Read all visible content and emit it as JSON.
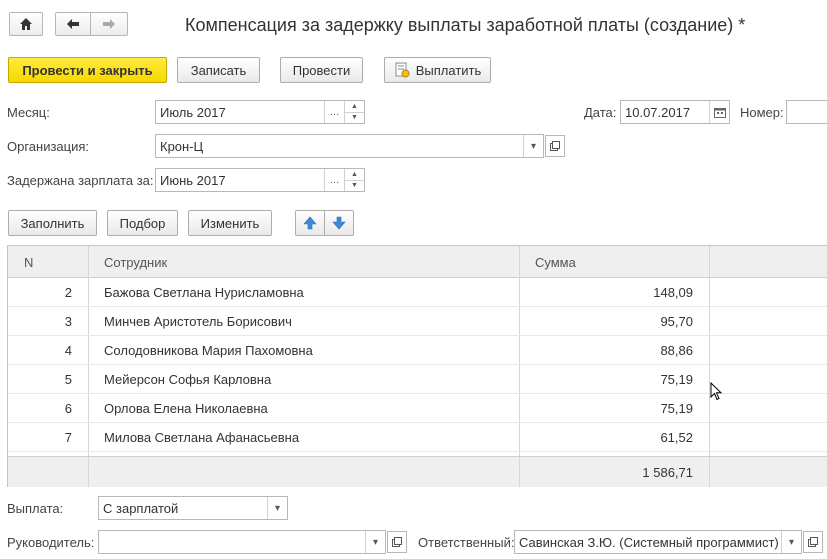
{
  "window": {
    "title": "Компенсация за задержку выплаты заработной платы (создание) *"
  },
  "nav": {
    "home_icon": "home-icon",
    "back_icon": "arrow-left-icon",
    "forward_icon": "arrow-right-icon"
  },
  "toolbar": {
    "post_close_label": "Провести и закрыть",
    "save_label": "Записать",
    "post_label": "Провести",
    "pay_label": "Выплатить"
  },
  "form": {
    "month_label": "Месяц:",
    "month_value": "Июль 2017",
    "date_label": "Дата:",
    "date_value": "10.07.2017",
    "number_label": "Номер:",
    "number_value": "",
    "org_label": "Организация:",
    "org_value": "Крон-Ц",
    "delayed_label": "Задержана зарплата за:",
    "delayed_value": "Июнь 2017"
  },
  "table_toolbar": {
    "fill_label": "Заполнить",
    "pick_label": "Подбор",
    "change_label": "Изменить"
  },
  "table": {
    "columns": [
      "N",
      "Сотрудник",
      "Сумма"
    ],
    "rows": [
      {
        "n": "2",
        "employee": "Бажова Светлана Нурисламовна",
        "sum": "148,09"
      },
      {
        "n": "3",
        "employee": "Минчев Аристотель Борисович",
        "sum": "95,70"
      },
      {
        "n": "4",
        "employee": "Солодовникова Мария Пахомовна",
        "sum": "88,86"
      },
      {
        "n": "5",
        "employee": "Мейерсон Софья Карловна",
        "sum": "75,19"
      },
      {
        "n": "6",
        "employee": "Орлова Елена Николаевна",
        "sum": "75,19"
      },
      {
        "n": "7",
        "employee": "Милова Светлана Афанасьевна",
        "sum": "61,52"
      }
    ],
    "total": "1 586,71"
  },
  "footer": {
    "payment_label": "Выплата:",
    "payment_value": "С зарплатой",
    "head_label": "Руководитель:",
    "head_value": "",
    "responsible_label": "Ответственный:",
    "responsible_value": "Савинская З.Ю. (Системный программист)"
  },
  "colors": {
    "primary_button": "#f6d800",
    "header_bg": "#efefef",
    "arrow_blue": "#3f8ad8"
  }
}
